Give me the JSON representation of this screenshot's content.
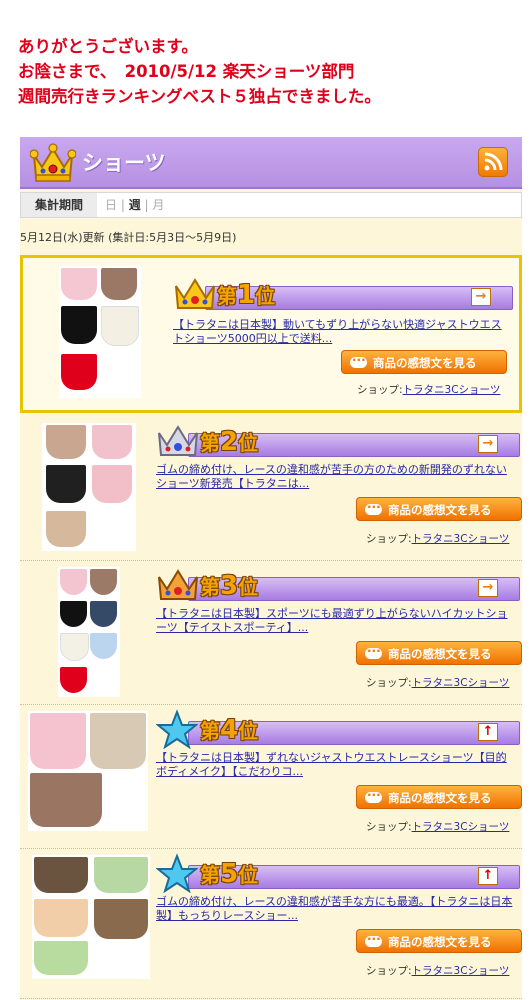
{
  "headline": {
    "line1": "ありがとうございます。",
    "line2": "お陰さまで、　2010/5/12 楽天ショーツ部門",
    "line3": "週間売行きランキングベスト５独占できました。"
  },
  "panel": {
    "title": "ショーツ",
    "rss_icon": "rss-icon",
    "crown_icon": "gold-crown-icon"
  },
  "period": {
    "label": "集計期間",
    "day": "日",
    "sep1": " | ",
    "week": "週",
    "sep2": " | ",
    "month": "月",
    "selected": "週"
  },
  "updated": "5月12日(水)更新 (集計日:5月3日～5月9日)",
  "colors": {
    "headline": "#e0001b",
    "accent_purple": "#b690e2",
    "button_orange": "#f07200",
    "link": "#2a2aa8",
    "panel_bg": "#fdf6d8"
  },
  "ranking": [
    {
      "rank_prefix": "第",
      "rank_number": "1",
      "rank_suffix": "位",
      "badge": "gold-crown-icon",
      "trend": "→",
      "trend_icon": "arrow-right-icon",
      "product_link": "【トラタニは日本製】動いてもずり上がらない快適ジャストウエストショーツ5000円以上で送料...",
      "review_button": "商品の感想文を見る",
      "shop_label": "ショップ:",
      "shop_name": "トラタニ3Cショーツ"
    },
    {
      "rank_prefix": "第",
      "rank_number": "2",
      "rank_suffix": "位",
      "badge": "silver-crown-icon",
      "trend": "→",
      "trend_icon": "arrow-right-icon",
      "product_link": "ゴムの締め付け、レースの違和感が苦手の方のための新開発のずれないショーツ新発売【トラタニは...",
      "review_button": "商品の感想文を見る",
      "shop_label": "ショップ:",
      "shop_name": "トラタニ3Cショーツ"
    },
    {
      "rank_prefix": "第",
      "rank_number": "3",
      "rank_suffix": "位",
      "badge": "bronze-crown-icon",
      "trend": "→",
      "trend_icon": "arrow-right-icon",
      "product_link": "【トラタニは日本製】スポーツにも最適ずり上がらないハイカットショーツ【テイストスポーティ】...",
      "review_button": "商品の感想文を見る",
      "shop_label": "ショップ:",
      "shop_name": "トラタニ3Cショーツ"
    },
    {
      "rank_prefix": "第",
      "rank_number": "4",
      "rank_suffix": "位",
      "badge": "star-icon",
      "trend": "↑",
      "trend_icon": "arrow-up-icon",
      "product_link": "【トラタニは日本製】ずれないジャストウエストレースショーツ【目的ボディメイク】【こだわりコ...",
      "review_button": "商品の感想文を見る",
      "shop_label": "ショップ:",
      "shop_name": "トラタニ3Cショーツ"
    },
    {
      "rank_prefix": "第",
      "rank_number": "5",
      "rank_suffix": "位",
      "badge": "star-icon",
      "trend": "↑",
      "trend_icon": "arrow-up-icon",
      "product_link": "ゴムの締め付け、レースの違和感が苦手な方にも最適。【トラタニは日本製】もっちりレースショー...",
      "review_button": "商品の感想文を見る",
      "shop_label": "ショップ:",
      "shop_name": "トラタニ3Cショーツ"
    }
  ]
}
